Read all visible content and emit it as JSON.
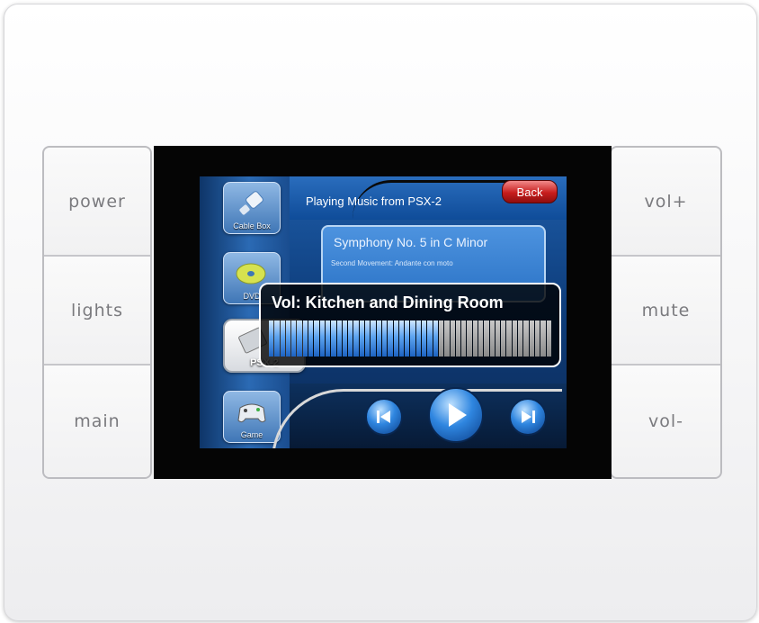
{
  "hardware_buttons": {
    "left": [
      {
        "id": "power",
        "label": "power"
      },
      {
        "id": "lights",
        "label": "lights"
      },
      {
        "id": "main",
        "label": "main"
      }
    ],
    "right": [
      {
        "id": "vol-up",
        "label": "vol+"
      },
      {
        "id": "mute",
        "label": "mute"
      },
      {
        "id": "vol-down",
        "label": "vol-"
      }
    ]
  },
  "screen": {
    "header": "Playing Music from PSX-2",
    "back_label": "Back",
    "sources": [
      {
        "label": "Cable Box",
        "icon": "cable-icon"
      },
      {
        "label": "DVD",
        "icon": "disc-icon"
      },
      {
        "label": "PSX-2",
        "icon": "playstation-icon",
        "selected": true
      },
      {
        "label": "Game",
        "icon": "gamepad-icon"
      }
    ],
    "track": {
      "title": "Symphony No. 5 in C Minor",
      "subtitle": "Second Movement: Andante con moto"
    },
    "transport": {
      "prev_icon": "skip-back-icon",
      "play_icon": "play-icon",
      "next_icon": "skip-forward-icon"
    }
  },
  "volume_overlay": {
    "title": "Vol: Kitchen and Dining Room",
    "level": 0.6
  },
  "colors": {
    "screen_blue": "#1d5ca8",
    "back_red": "#c71d1d",
    "volume_fill": "#5da4f0"
  }
}
